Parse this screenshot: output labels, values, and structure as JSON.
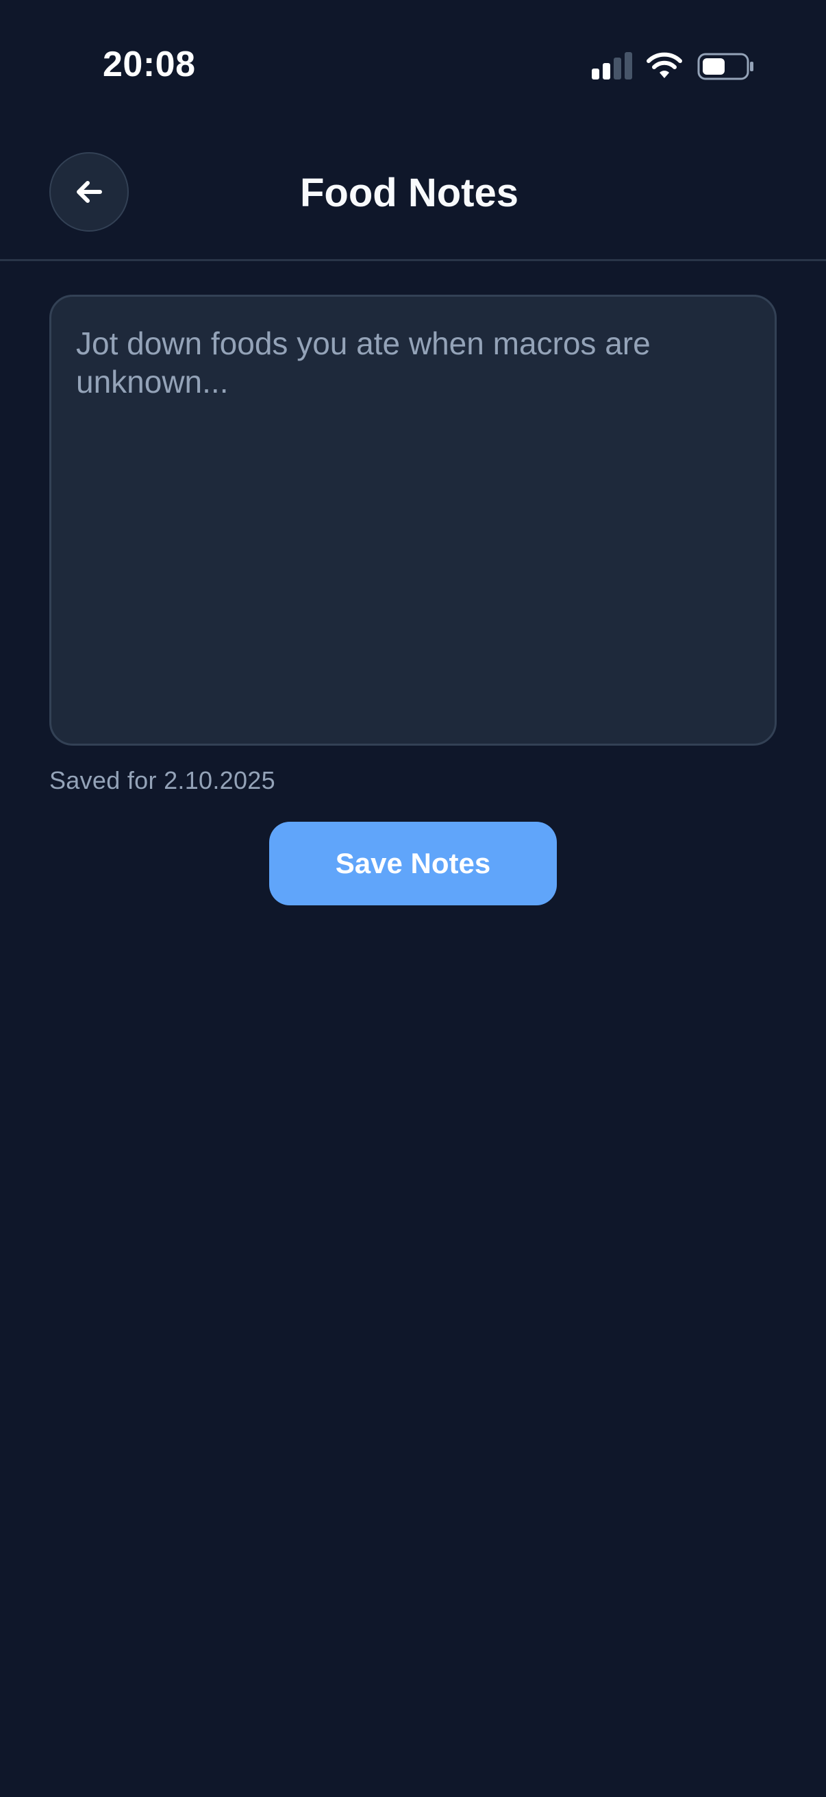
{
  "status_bar": {
    "time": "20:08",
    "icons": [
      "signal-icon",
      "wifi-icon",
      "battery-icon"
    ]
  },
  "header": {
    "back_icon": "arrow-left-icon",
    "title": "Food Notes"
  },
  "notes": {
    "value": "",
    "placeholder": "Jot down foods you ate when macros are unknown..."
  },
  "saved_label": "Saved for 2.10.2025",
  "save_button_label": "Save Notes",
  "colors": {
    "background": "#0f172a",
    "surface": "#1e293b",
    "border": "#334155",
    "accent": "#60a5fa",
    "muted_text": "#94a3b8"
  }
}
